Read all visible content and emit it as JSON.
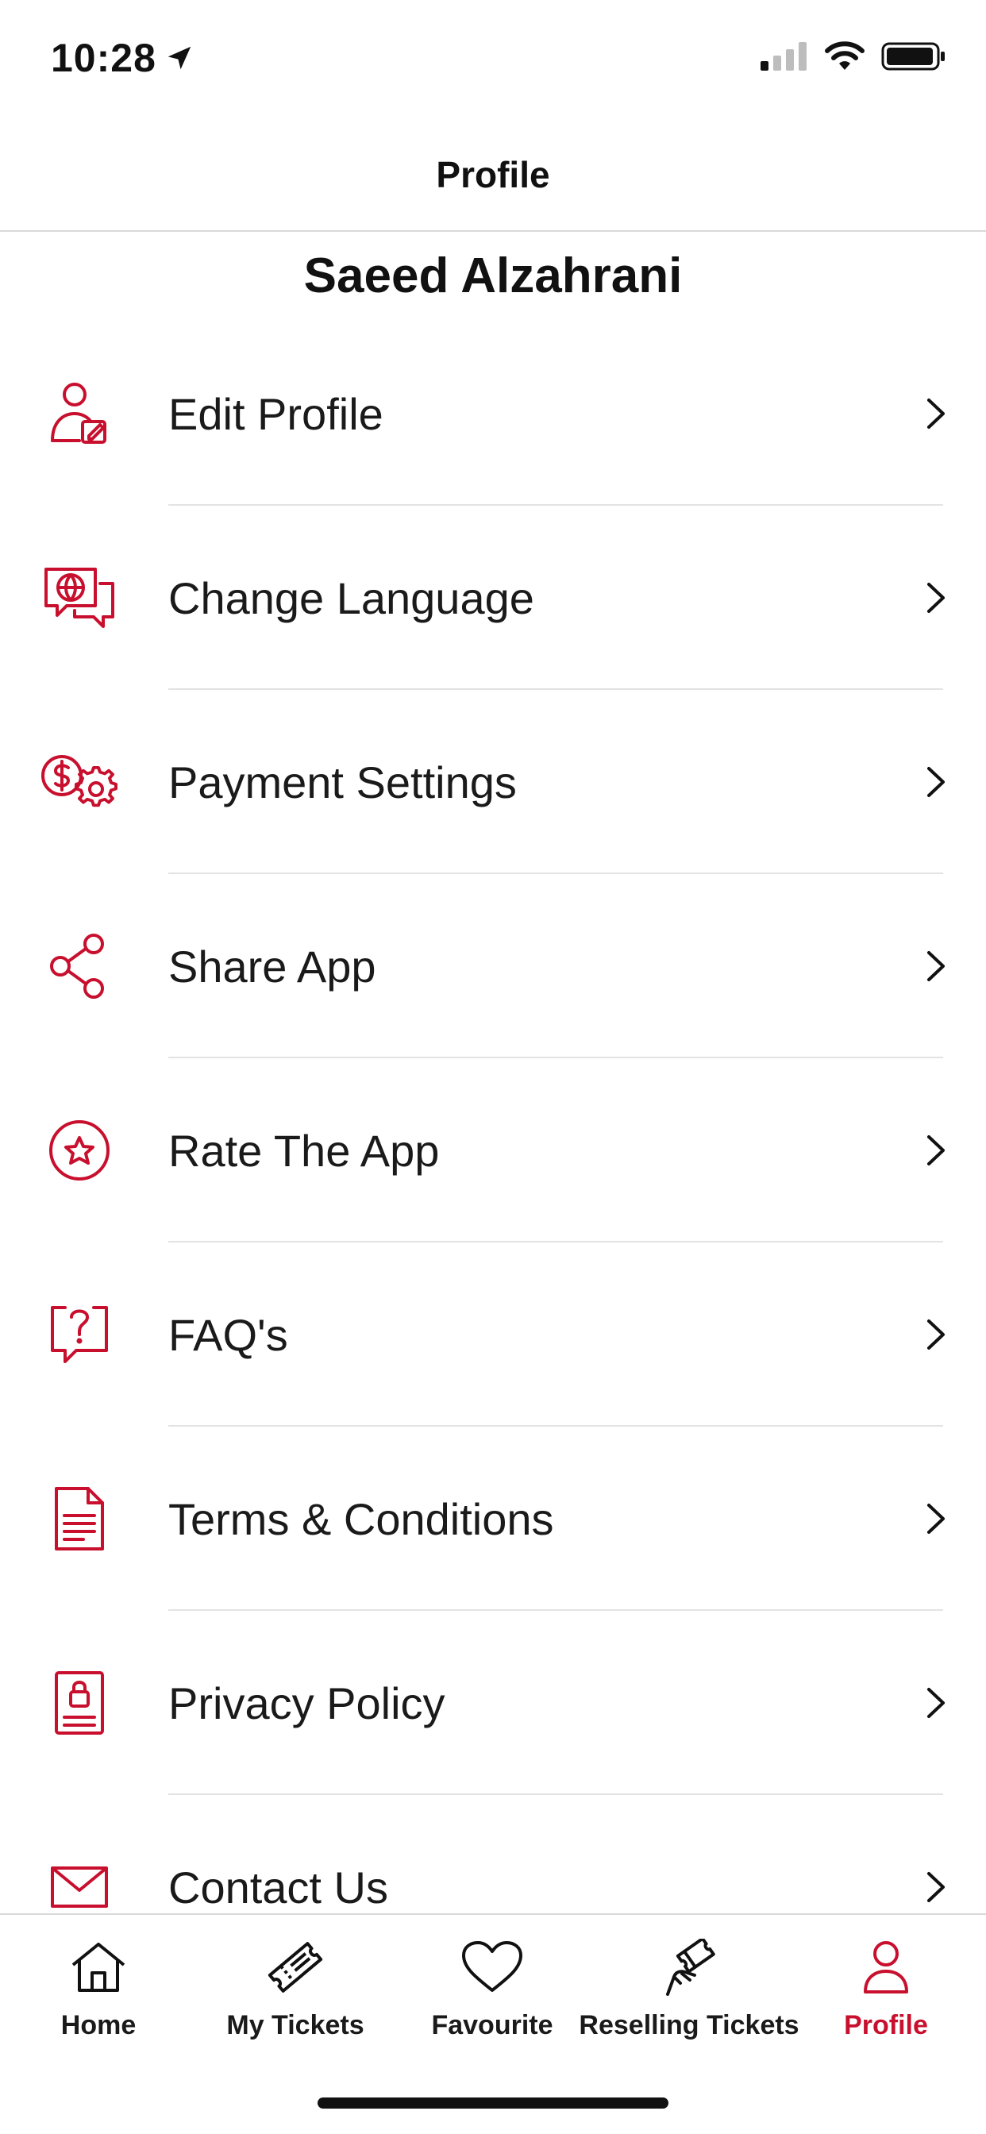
{
  "status_bar": {
    "time": "10:28"
  },
  "header": {
    "title": "Profile"
  },
  "user": {
    "name": "Saeed Alzahrani"
  },
  "menu": {
    "items": [
      {
        "label": "Edit Profile",
        "icon": "user-edit-icon"
      },
      {
        "label": "Change Language",
        "icon": "language-chat-icon"
      },
      {
        "label": "Payment Settings",
        "icon": "payment-settings-icon"
      },
      {
        "label": "Share App",
        "icon": "share-icon"
      },
      {
        "label": "Rate The App",
        "icon": "star-rate-icon"
      },
      {
        "label": "FAQ's",
        "icon": "question-chat-icon"
      },
      {
        "label": "Terms & Conditions",
        "icon": "document-icon"
      },
      {
        "label": "Privacy Policy",
        "icon": "privacy-lock-icon"
      },
      {
        "label": "Contact Us",
        "icon": "mail-icon"
      }
    ]
  },
  "tab_bar": {
    "tabs": [
      {
        "label": "Home",
        "icon": "home-icon",
        "active": false
      },
      {
        "label": "My Tickets",
        "icon": "ticket-icon",
        "active": false
      },
      {
        "label": "Favourite",
        "icon": "heart-icon",
        "active": false
      },
      {
        "label": "Reselling Tickets",
        "icon": "resell-ticket-icon",
        "active": false
      },
      {
        "label": "Profile",
        "icon": "profile-icon",
        "active": true
      }
    ]
  },
  "colors": {
    "accent": "#c8102e",
    "text": "#111111",
    "divider": "#e3e3e3"
  }
}
